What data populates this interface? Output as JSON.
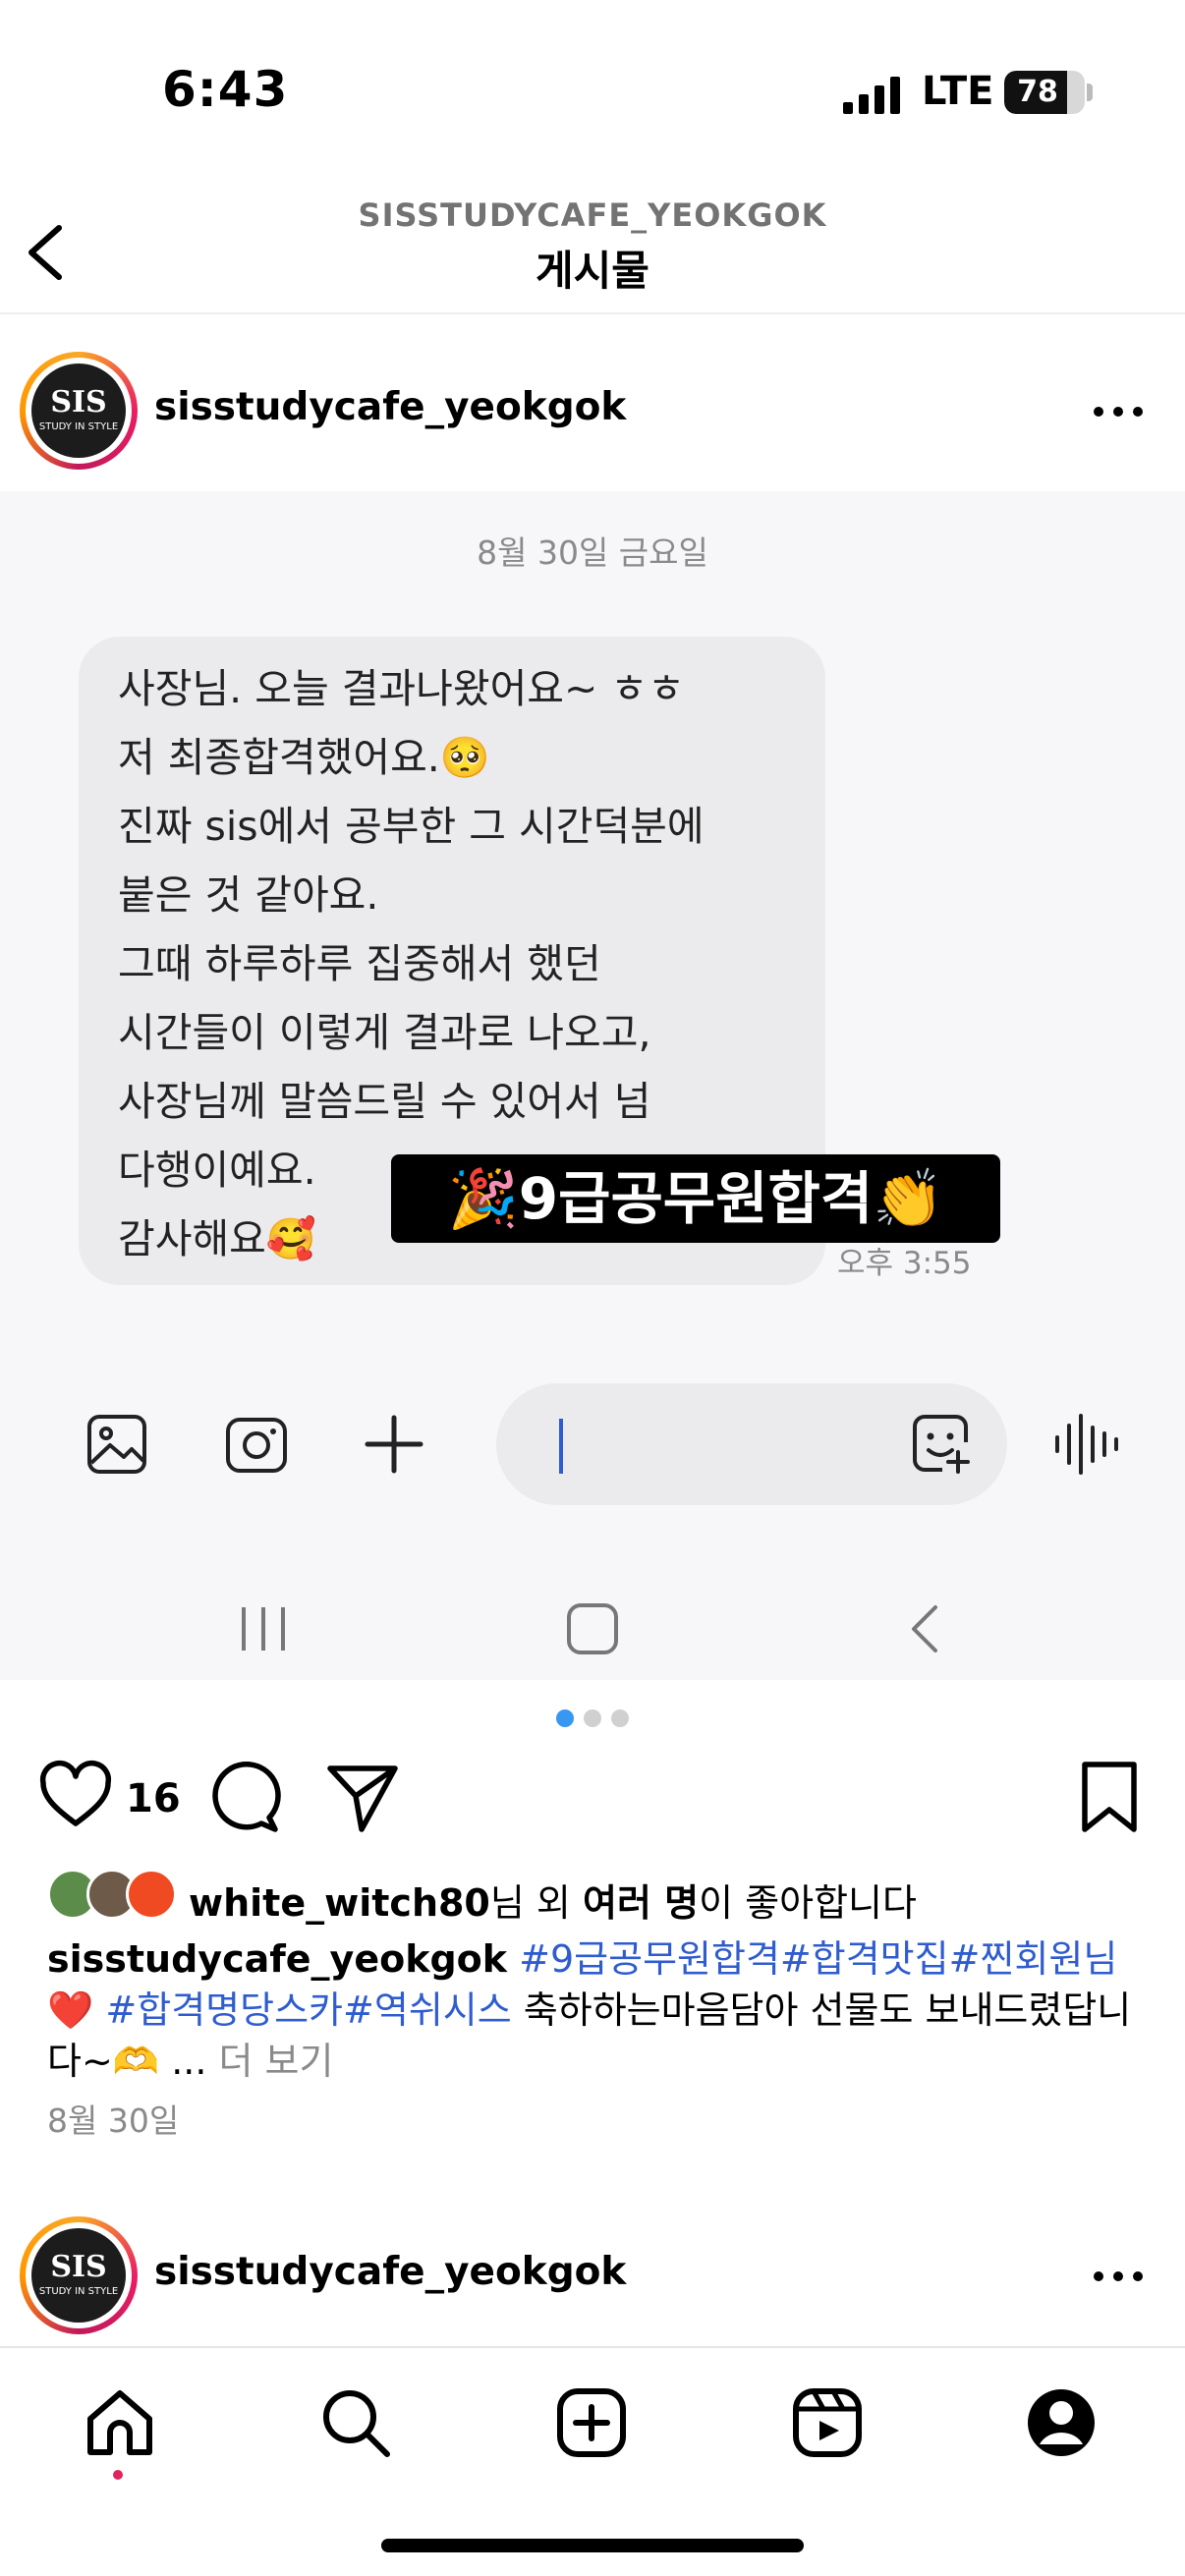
{
  "status": {
    "time": "6:43",
    "network": "LTE",
    "battery": "78",
    "battery_level": 0.78
  },
  "header": {
    "account": "SISSTUDYCAFE_YEOKGOK",
    "title": "게시물"
  },
  "post": {
    "username": "sisstudycafe_yeokgok",
    "avatar_text": "SIS",
    "avatar_sub": "STUDY IN STYLE",
    "media": {
      "date_divider": "8월 30일 금요일",
      "message_lines": [
        "사장님. 오늘 결과나왔어요~ ㅎㅎ",
        "저 최종합격했어요.🥺",
        "진짜 sis에서 공부한 그 시간덕분에",
        "붙은 것 같아요.",
        "그때 하루하루 집중해서 했던",
        "시간들이 이렇게 결과로 나오고,",
        "사장님께 말씀드릴 수 있어서 넘",
        "다행이예요.",
        "감사해요🥰"
      ],
      "sticker": "🎉9급공무원합격👏",
      "time": "오후 3:55"
    },
    "carousel": {
      "total": 3,
      "active": 1
    },
    "likes_count": "16",
    "liked_by": {
      "user": "white_witch80",
      "suffix1": "님 외 ",
      "bold": "여러 명",
      "suffix2": "이 좋아합니다"
    },
    "caption": {
      "username": "sisstudycafe_yeokgok",
      "tags1": "#9급공무원합격#합격맛집#찐회원님",
      "heart": "❤️",
      "tags2": "#합격명당스카#역쉬시스",
      "text": " 축하하는마음담아 선물도 보내드렸답니다~🫶 ...",
      "more": " 더 보기"
    },
    "date": "8월 30일"
  },
  "next_post": {
    "username": "sisstudycafe_yeokgok"
  },
  "colors": {
    "link": "#2f5ccf",
    "accent_dot": "#3897f0",
    "notify": "#e0245e"
  }
}
